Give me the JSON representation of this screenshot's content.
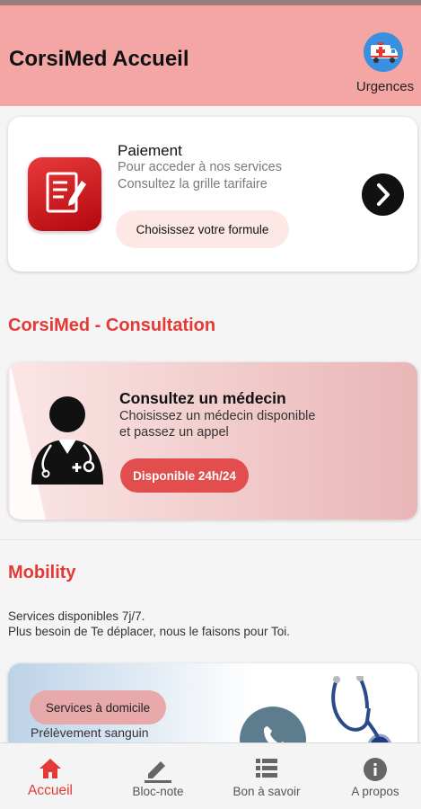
{
  "header": {
    "title": "CorsiMed Accueil",
    "urgences_label": "Urgences",
    "urgences_icon": "ambulance-icon",
    "bg_color": "#f3a6a4"
  },
  "payment_card": {
    "icon": "document-edit-icon",
    "title": "Paiement",
    "line1": "Pour acceder à nos services",
    "line2": "Consultez la grille tarifaire",
    "button_label": "Choisissez votre formule",
    "arrow_icon": "chevron-right-icon"
  },
  "consultation": {
    "section_title": "CorsiMed - Consultation",
    "icon": "doctor-icon",
    "title": "Consultez un médecin",
    "line1": "Choisissez un médecin disponible",
    "line2": "et passez un appel",
    "badge_label": "Disponible 24h/24"
  },
  "mobility": {
    "section_title": "Mobility",
    "line1": "Services disponibles 7j/7.",
    "line2": "Plus besoin de Te déplacer, nous le faisons pour Toi.",
    "home_button_label": "Services à domicile",
    "home_sub": "Prélèvement sanguin",
    "phone_icon": "phone-icon",
    "stethoscope_icon": "stethoscope-icon"
  },
  "bottom_nav": {
    "items": [
      {
        "label": "Accueil",
        "icon": "home-icon",
        "active": true
      },
      {
        "label": "Bloc-note",
        "icon": "pencil-icon",
        "active": false
      },
      {
        "label": "Bon à savoir",
        "icon": "list-icon",
        "active": false
      },
      {
        "label": "A propos",
        "icon": "info-icon",
        "active": false
      }
    ]
  },
  "colors": {
    "accent": "#e53935",
    "dark": "#111111"
  }
}
